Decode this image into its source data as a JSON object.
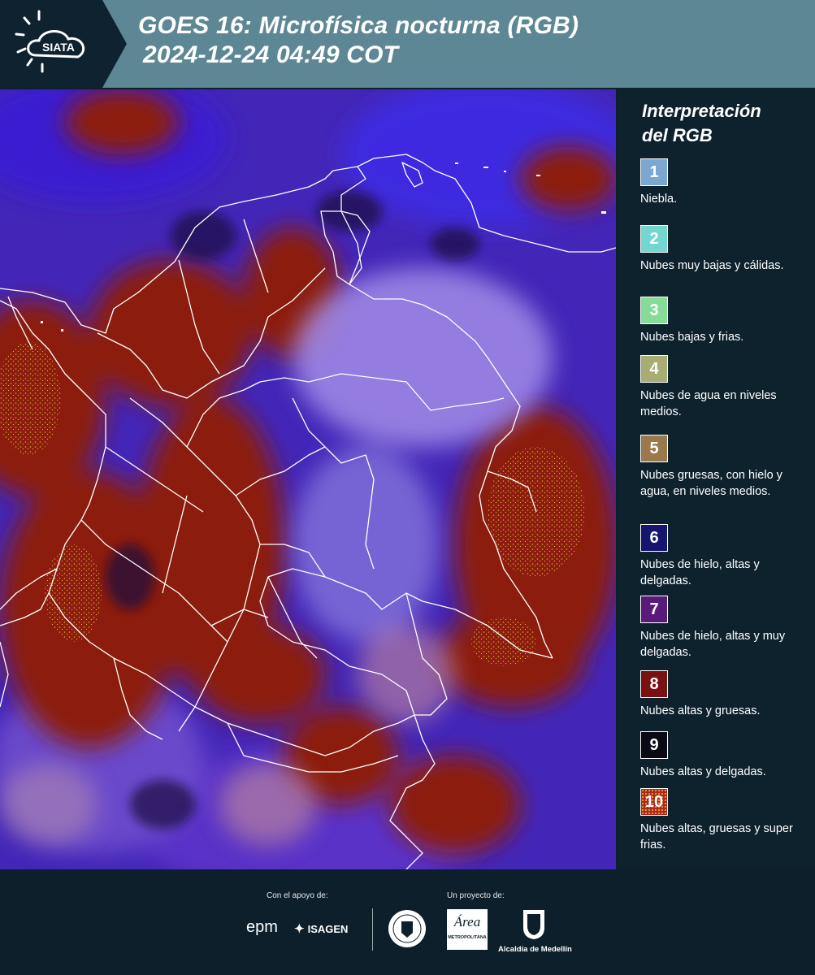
{
  "header": {
    "brand": "SIATA",
    "title_line1": "GOES 16: Microfísica nocturna (RGB)",
    "title_line2": "2024-12-24 04:49 COT"
  },
  "legend": {
    "title_line1": "Interpretación",
    "title_line2": "del RGB",
    "items": [
      {
        "num": "1",
        "label": "Niebla.",
        "color": "#7ba7d0"
      },
      {
        "num": "2",
        "label": "Nubes muy bajas y cálidas.",
        "color": "#74d6d0"
      },
      {
        "num": "3",
        "label": "Nubes bajas y frias.",
        "color": "#86dc96"
      },
      {
        "num": "4",
        "label": "Nubes de agua en niveles medios.",
        "color": "#a8ad74"
      },
      {
        "num": "5",
        "label": "Nubes gruesas, con hielo y agua, en niveles medios.",
        "color": "#9a7a4c"
      },
      {
        "num": "6",
        "label": "Nubes de hielo, altas y delgadas.",
        "color": "#16166e"
      },
      {
        "num": "7",
        "label": "Nubes de hielo, altas y muy delgadas.",
        "color": "#5a1a7a"
      },
      {
        "num": "8",
        "label": "Nubes altas y gruesas.",
        "color": "#7a1010"
      },
      {
        "num": "9",
        "label": "Nubes altas y delgadas.",
        "color": "#0a0a14"
      },
      {
        "num": "10",
        "label": "Nubes altas, gruesas y super frias.",
        "color": "#b0261a"
      }
    ]
  },
  "footer": {
    "support_label": "Con el apoyo de:",
    "project_label": "Un proyecto de:",
    "sponsor1": "epm",
    "sponsor2": "ISAGEN",
    "partner1_top": "Área",
    "partner1_sub": "METROPOLITANA",
    "partner2": "Alcaldía de Medellín"
  },
  "colors": {
    "header_bg": "#5e8795",
    "panel_bg": "#0e222e",
    "map_blue": "#4a2aa8",
    "map_red": "#8a1e12"
  }
}
